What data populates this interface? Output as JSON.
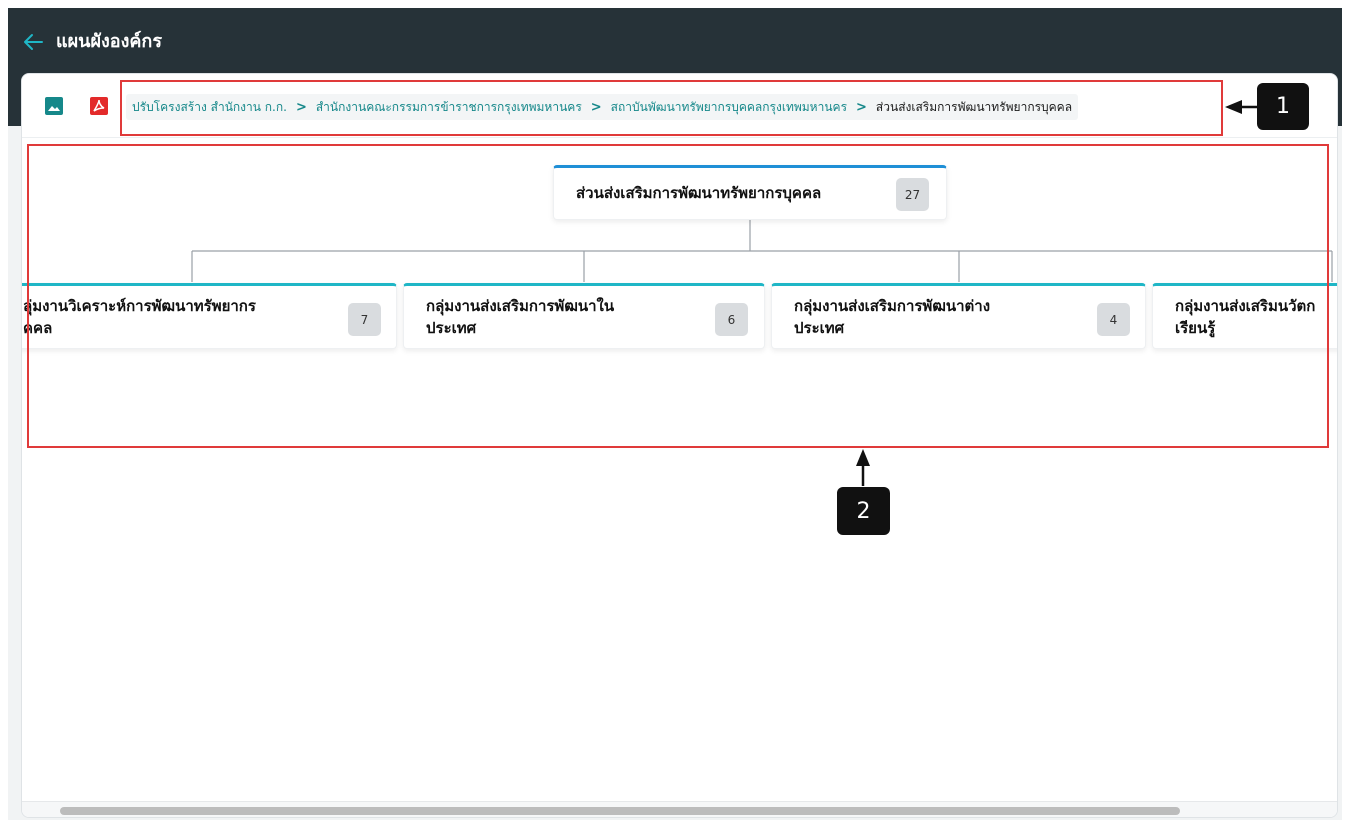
{
  "header": {
    "title": "แผนผังองค์กร",
    "back_icon": "back-arrow-icon"
  },
  "toolbar": {
    "image_icon": "image-icon",
    "pdf_icon": "pdf-icon",
    "icon_color_image": "#16888a",
    "icon_color_pdf": "#e32a2a"
  },
  "breadcrumb": {
    "items": [
      "ปรับโครงสร้าง สำนักงาน ก.ก.",
      "สำนักงานคณะกรรมการข้าราชการกรุงเทพมหานคร",
      "สถาบันพัฒนาทรัพยากรบุคคลกรุงเทพมหานคร"
    ],
    "current": "ส่วนส่งเสริมการพัฒนาทรัพยากรบุคคล",
    "separator": ">"
  },
  "org_chart": {
    "root": {
      "title": "ส่วนส่งเสริมการพัฒนาทรัพยากรบุคคล",
      "count": "27"
    },
    "children": [
      {
        "title_line1": "ลุ่มงานวิเคราะห์การพัฒนาทรัพยากร",
        "title_line2": "คคล",
        "count": "7"
      },
      {
        "title_line1": "กลุ่มงานส่งเสริมการพัฒนาใน",
        "title_line2": "ประเทศ",
        "count": "6"
      },
      {
        "title_line1": "กลุ่มงานส่งเสริมการพัฒนาต่าง",
        "title_line2": "ประเทศ",
        "count": "4"
      },
      {
        "title_line1": "กลุ่มงานส่งเสริมนวัตก",
        "title_line2": "เรียนรู้",
        "count": ""
      }
    ],
    "accent_root": "#1f8fd6",
    "accent_child": "#1fb6c6"
  },
  "annotations": {
    "badge1": "1",
    "badge2": "2",
    "color": "#e03a3a"
  }
}
